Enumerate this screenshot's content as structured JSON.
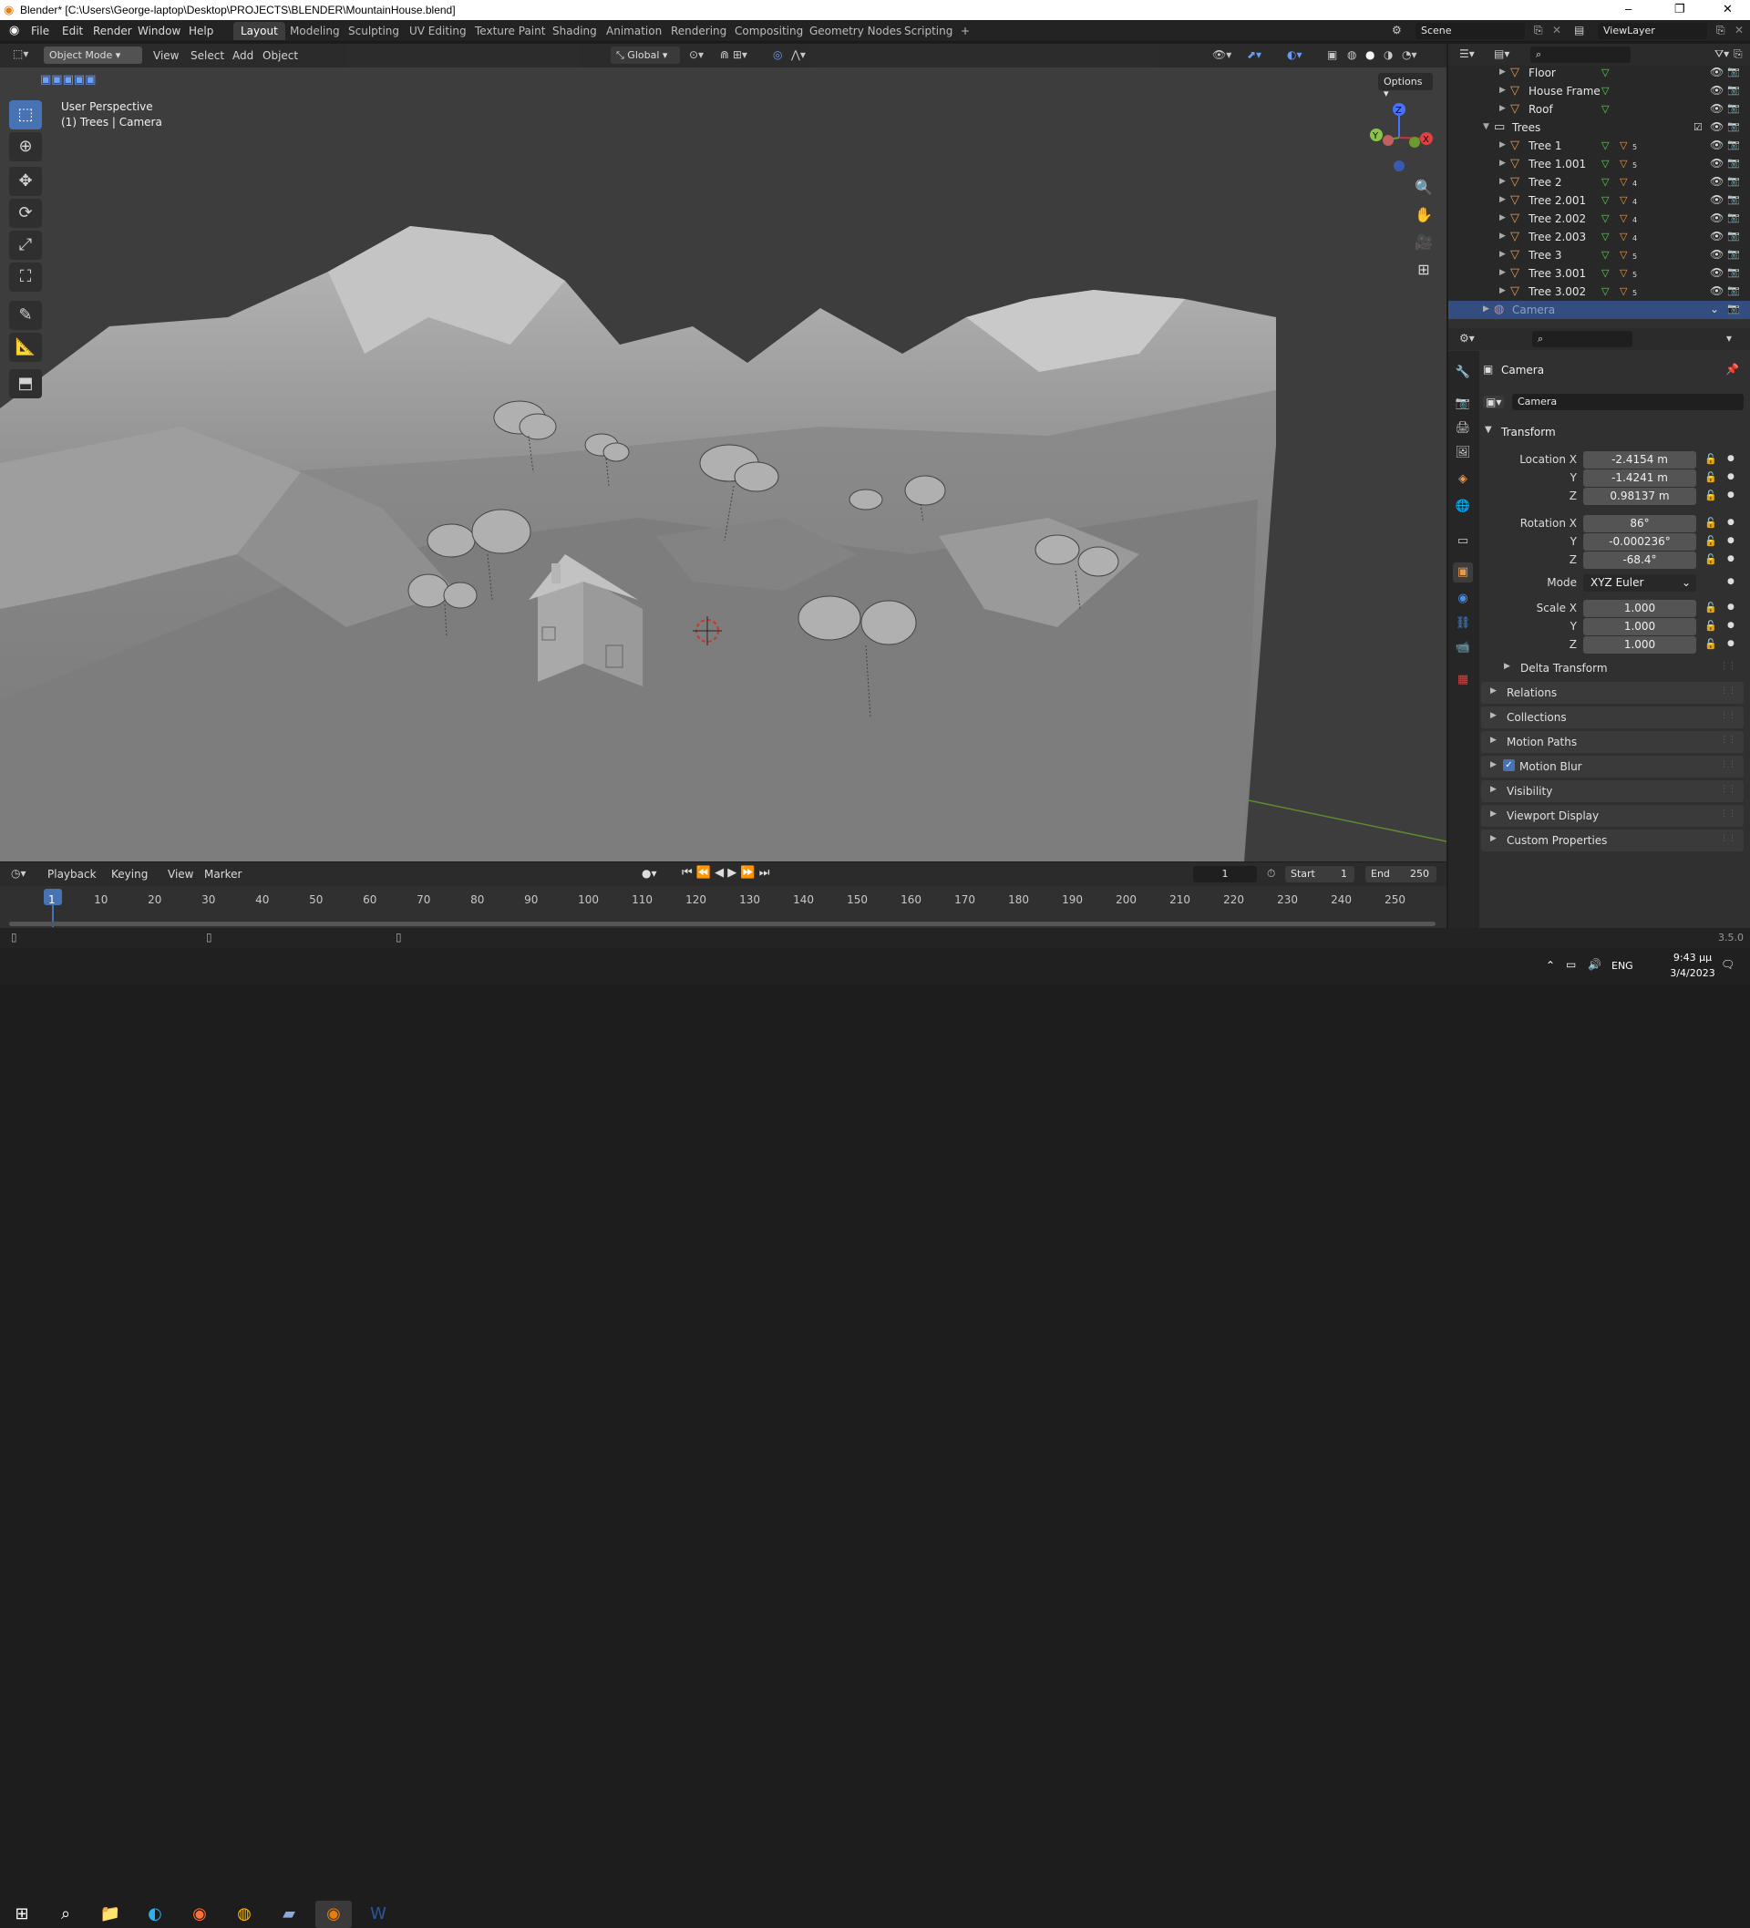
{
  "window": {
    "title": "Blender* [C:\\Users\\George-laptop\\Desktop\\PROJECTS\\BLENDER\\MountainHouse.blend]",
    "controls": [
      "–",
      "❐",
      "✕"
    ]
  },
  "menu": [
    "File",
    "Edit",
    "Render",
    "Window",
    "Help"
  ],
  "workspaces": [
    "Layout",
    "Modeling",
    "Sculpting",
    "UV Editing",
    "Texture Paint",
    "Shading",
    "Animation",
    "Rendering",
    "Compositing",
    "Geometry Nodes",
    "Scripting",
    "+"
  ],
  "scene": {
    "name": "Scene",
    "viewlayer": "ViewLayer"
  },
  "viewport": {
    "mode": "Object Mode",
    "menus": [
      "View",
      "Select",
      "Add",
      "Object"
    ],
    "orientation": "Global",
    "options": "Options",
    "info_line1": "User Perspective",
    "info_line2": "(1) Trees | Camera",
    "gizmo": {
      "z": "Z",
      "y": "Y",
      "x": "X"
    }
  },
  "tools": [
    "select-box",
    "cursor",
    "move",
    "rotate",
    "scale",
    "transform",
    "annotate",
    "measure",
    "add-cube"
  ],
  "outliner": {
    "items": [
      {
        "name": "Floor",
        "level": 1,
        "badge": ""
      },
      {
        "name": "House Frame",
        "level": 1,
        "badge": ""
      },
      {
        "name": "Roof",
        "level": 1,
        "badge": ""
      },
      {
        "name": "Trees",
        "level": 0,
        "badge": "collection"
      },
      {
        "name": "Tree 1",
        "level": 1,
        "badge": "5"
      },
      {
        "name": "Tree 1.001",
        "level": 1,
        "badge": "5"
      },
      {
        "name": "Tree 2",
        "level": 1,
        "badge": "4"
      },
      {
        "name": "Tree 2.001",
        "level": 1,
        "badge": "4"
      },
      {
        "name": "Tree 2.002",
        "level": 1,
        "badge": "4"
      },
      {
        "name": "Tree 2.003",
        "level": 1,
        "badge": "4"
      },
      {
        "name": "Tree 3",
        "level": 1,
        "badge": "5"
      },
      {
        "name": "Tree 3.001",
        "level": 1,
        "badge": "5"
      },
      {
        "name": "Tree 3.002",
        "level": 1,
        "badge": "5"
      },
      {
        "name": "Camera",
        "level": 0,
        "badge": "selected"
      }
    ]
  },
  "properties": {
    "object_name": "Camera",
    "datablock": "Camera",
    "transform_label": "Transform",
    "location": {
      "label": "Location X",
      "x": "-2.4154 m",
      "y": "-1.4241 m",
      "z": "0.98137 m"
    },
    "rotation": {
      "label": "Rotation X",
      "x": "86°",
      "y": "-0.000236°",
      "z": "-68.4°"
    },
    "mode": {
      "label": "Mode",
      "value": "XYZ Euler"
    },
    "scale": {
      "label": "Scale X",
      "x": "1.000",
      "y": "1.000",
      "z": "1.000"
    },
    "axis_y": "Y",
    "axis_z": "Z",
    "sections": [
      "Delta Transform",
      "Relations",
      "Collections",
      "Motion Paths",
      "Motion Blur",
      "Visibility",
      "Viewport Display",
      "Custom Properties"
    ]
  },
  "timeline": {
    "menus": [
      "Playback",
      "Keying",
      "View",
      "Marker"
    ],
    "current": "1",
    "start_label": "Start",
    "start": "1",
    "end_label": "End",
    "end": "250",
    "ticks": [
      "1",
      "10",
      "20",
      "30",
      "40",
      "50",
      "60",
      "70",
      "80",
      "90",
      "100",
      "110",
      "120",
      "130",
      "140",
      "150",
      "160",
      "170",
      "180",
      "190",
      "200",
      "210",
      "220",
      "230",
      "240",
      "250"
    ]
  },
  "status": {
    "version": "3.5.0"
  },
  "taskbar": {
    "lang": "ENG",
    "time": "9:43 μμ",
    "date": "3/4/2023"
  },
  "colors": {
    "accent": "#4772b3",
    "selection": "#334d80",
    "viewport": "#3d3d3d",
    "orange": "#e89a4c"
  }
}
